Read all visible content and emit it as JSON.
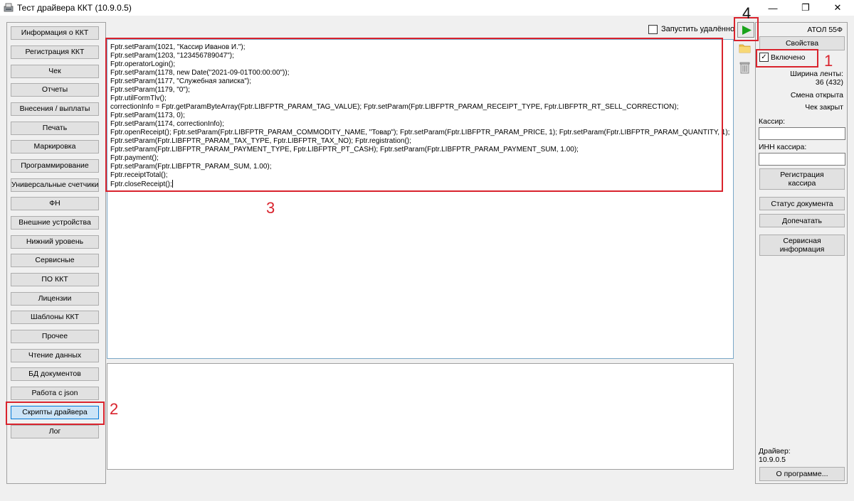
{
  "window": {
    "title": "Тест драйвера ККТ (10.9.0.5)",
    "controls": {
      "minimize": "—",
      "restore": "❐",
      "close": "✕"
    }
  },
  "nav": {
    "items": [
      "Информация о ККТ",
      "Регистрация ККТ",
      "Чек",
      "Отчеты",
      "Внесения / выплаты",
      "Печать",
      "Маркировка",
      "Программирование",
      "Универсальные счетчики",
      "ФН",
      "Внешние устройства",
      "Нижний уровень",
      "Сервисные",
      "ПО ККТ",
      "Лицензии",
      "Шаблоны ККТ",
      "Прочее",
      "Чтение данных",
      "БД документов",
      "Работа с json",
      "Скрипты драйвера",
      "Лог"
    ],
    "active_index": 20
  },
  "toolbar": {
    "remote_label": "Запустить удалённо",
    "remote_checked": false,
    "run_icon": "play-icon",
    "open_icon": "folder-icon",
    "delete_icon": "trash-icon",
    "accent": "#1aa31a"
  },
  "editor": {
    "lines": [
      "Fptr.setParam(1021, \"Кассир Иванов И.\");",
      "Fptr.setParam(1203, \"123456789047\");",
      "Fptr.operatorLogin();",
      "Fptr.setParam(1178, new Date(\"2021-09-01T00:00:00\"));",
      "Fptr.setParam(1177, \"Служебная записка\");",
      "Fptr.setParam(1179, \"0\");",
      "Fptr.utilFormTlv();",
      "correctionInfo = Fptr.getParamByteArray(Fptr.LIBFPTR_PARAM_TAG_VALUE); Fptr.setParam(Fptr.LIBFPTR_PARAM_RECEIPT_TYPE, Fptr.LIBFPTR_RT_SELL_CORRECTION);",
      "Fptr.setParam(1173, 0);",
      "Fptr.setParam(1174, correctionInfo);",
      "Fptr.openReceipt(); Fptr.setParam(Fptr.LIBFPTR_PARAM_COMMODITY_NAME, \"Товар\"); Fptr.setParam(Fptr.LIBFPTR_PARAM_PRICE, 1); Fptr.setParam(Fptr.LIBFPTR_PARAM_QUANTITY, 1);",
      "Fptr.setParam(Fptr.LIBFPTR_PARAM_TAX_TYPE, Fptr.LIBFPTR_TAX_NO); Fptr.registration();",
      "Fptr.setParam(Fptr.LIBFPTR_PARAM_PAYMENT_TYPE, Fptr.LIBFPTR_PT_CASH); Fptr.setParam(Fptr.LIBFPTR_PARAM_PAYMENT_SUM, 1.00);",
      "Fptr.payment();",
      "Fptr.setParam(Fptr.LIBFPTR_PARAM_SUM, 1.00);",
      "Fptr.receiptTotal();",
      "Fptr.closeReceipt();"
    ]
  },
  "right": {
    "device": "АТОЛ 55Ф",
    "properties_button": "Свойства",
    "enabled_label": "Включено",
    "enabled_checked": true,
    "tape_width_label": "Ширина ленты:",
    "tape_width_value": "36 (432)",
    "shift_status": "Смена открыта",
    "receipt_status": "Чек закрыт",
    "cashier_label": "Кассир:",
    "cashier_value": "",
    "inn_label": "ИНН кассира:",
    "inn_value": "",
    "register_cashier_button_line1": "Регистрация",
    "register_cashier_button_line2": "кассира",
    "doc_status_button": "Статус документа",
    "reprint_button": "Допечатать",
    "service_info_line1": "Сервисная",
    "service_info_line2": "информация",
    "driver_label": "Драйвер:",
    "driver_version": "10.9.0.5",
    "about_button": "О программе..."
  },
  "annotations": {
    "n1": "1",
    "n2": "2",
    "n3": "3",
    "n4": "4",
    "color": "#d9232d"
  }
}
